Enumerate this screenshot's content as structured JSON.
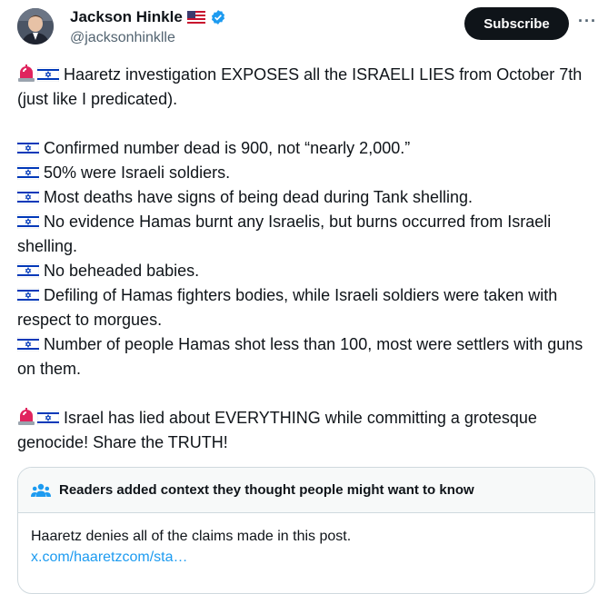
{
  "author": {
    "name": "Jackson Hinkle",
    "handle": "@jacksonhinklle",
    "flag_icon": "us-flag-icon",
    "verified_icon": "verified-badge-icon"
  },
  "actions": {
    "subscribe_label": "Subscribe",
    "more_label": "···"
  },
  "tweet": {
    "lines": [
      {
        "emoji": [
          "siren-icon",
          "israel-flag-icon"
        ],
        "text": "Haaretz investigation EXPOSES all the ISRAELI LIES from October 7th (just like I predicated)."
      },
      {
        "emoji": [
          "israel-flag-icon"
        ],
        "text": "Confirmed number dead is 900, not “nearly 2,000.”"
      },
      {
        "emoji": [
          "israel-flag-icon"
        ],
        "text": "50% were Israeli soldiers."
      },
      {
        "emoji": [
          "israel-flag-icon"
        ],
        "text": "Most deaths have signs of being dead during Tank shelling."
      },
      {
        "emoji": [
          "israel-flag-icon"
        ],
        "text": "No evidence Hamas burnt any Israelis, but burns occurred from Israeli shelling."
      },
      {
        "emoji": [
          "israel-flag-icon"
        ],
        "text": "No beheaded babies."
      },
      {
        "emoji": [
          "israel-flag-icon"
        ],
        "text": "Defiling of Hamas fighters bodies, while Israeli soldiers were taken with respect to morgues."
      },
      {
        "emoji": [
          "israel-flag-icon"
        ],
        "text": "Number of people Hamas shot less than 100, most were settlers with guns on them."
      },
      {
        "emoji": [
          "siren-icon",
          "israel-flag-icon"
        ],
        "text": "Israel has lied about EVERYTHING while committing a grotesque genocide! Share the TRUTH!"
      }
    ]
  },
  "community_note": {
    "title": "Readers added context they thought people might want to know",
    "icon": "people-icon",
    "body": "Haaretz denies all of the claims made in this post.",
    "link": "x.com/haaretzcom/sta…"
  },
  "colors": {
    "accent": "#1d9bf0",
    "text": "#0f1419",
    "secondary": "#536471",
    "button_bg": "#0f1419"
  }
}
